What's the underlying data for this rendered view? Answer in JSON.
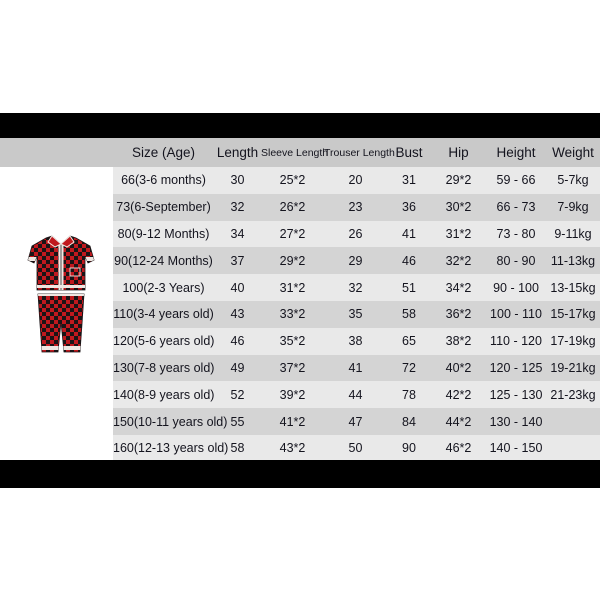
{
  "page": {
    "background_color": "#ffffff",
    "letterbox_color": "#000000",
    "header_row_color": "#c9c9c9",
    "row_color_odd": "#e9e9e9",
    "row_color_even": "#d4d4d4",
    "text_color": "#14141e"
  },
  "product": {
    "name": "pajama-set",
    "description": "Red and black buffalo plaid long-sleeve pajama set with white piping trim and ruffled cuffs",
    "plaid_red": "#c0191e",
    "plaid_black": "#1a1416",
    "trim_color": "#efe7e2"
  },
  "table": {
    "headers": [
      "Size (Age)",
      "Length",
      "Sleeve Length",
      "Trouser Length",
      "Bust",
      "Hip",
      "Height",
      "Weight"
    ],
    "rows": [
      {
        "size": "66(3-6 months)",
        "length": "30",
        "sleeve_length": "25*2",
        "trouser_length": "20",
        "bust": "31",
        "hip": "29*2",
        "height": "59 - 66",
        "weight": "5-7kg"
      },
      {
        "size": "73(6-September)",
        "length": "32",
        "sleeve_length": "26*2",
        "trouser_length": "23",
        "bust": "36",
        "hip": "30*2",
        "height": "66 - 73",
        "weight": "7-9kg"
      },
      {
        "size": "80(9-12 Months)",
        "length": "34",
        "sleeve_length": "27*2",
        "trouser_length": "26",
        "bust": "41",
        "hip": "31*2",
        "height": "73 - 80",
        "weight": "9-11kg"
      },
      {
        "size": "90(12-24 Months)",
        "length": "37",
        "sleeve_length": "29*2",
        "trouser_length": "29",
        "bust": "46",
        "hip": "32*2",
        "height": "80 - 90",
        "weight": "11-13kg"
      },
      {
        "size": "100(2-3 Years)",
        "length": "40",
        "sleeve_length": "31*2",
        "trouser_length": "32",
        "bust": "51",
        "hip": "34*2",
        "height": "90 - 100",
        "weight": "13-15kg"
      },
      {
        "size": "110(3-4 years old)",
        "length": "43",
        "sleeve_length": "33*2",
        "trouser_length": "35",
        "bust": "58",
        "hip": "36*2",
        "height": "100 - 110",
        "weight": "15-17kg"
      },
      {
        "size": "120(5-6 years old)",
        "length": "46",
        "sleeve_length": "35*2",
        "trouser_length": "38",
        "bust": "65",
        "hip": "38*2",
        "height": "110 - 120",
        "weight": "17-19kg"
      },
      {
        "size": "130(7-8 years old)",
        "length": "49",
        "sleeve_length": "37*2",
        "trouser_length": "41",
        "bust": "72",
        "hip": "40*2",
        "height": "120 - 125",
        "weight": "19-21kg"
      },
      {
        "size": "140(8-9 years old)",
        "length": "52",
        "sleeve_length": "39*2",
        "trouser_length": "44",
        "bust": "78",
        "hip": "42*2",
        "height": "125 - 130",
        "weight": "21-23kg"
      },
      {
        "size": "150(10-11 years old)",
        "length": "55",
        "sleeve_length": "41*2",
        "trouser_length": "47",
        "bust": "84",
        "hip": "44*2",
        "height": "130 - 140",
        "weight": ""
      },
      {
        "size": "160(12-13 years old)",
        "length": "58",
        "sleeve_length": "43*2",
        "trouser_length": "50",
        "bust": "90",
        "hip": "46*2",
        "height": "140 - 150",
        "weight": ""
      }
    ]
  }
}
